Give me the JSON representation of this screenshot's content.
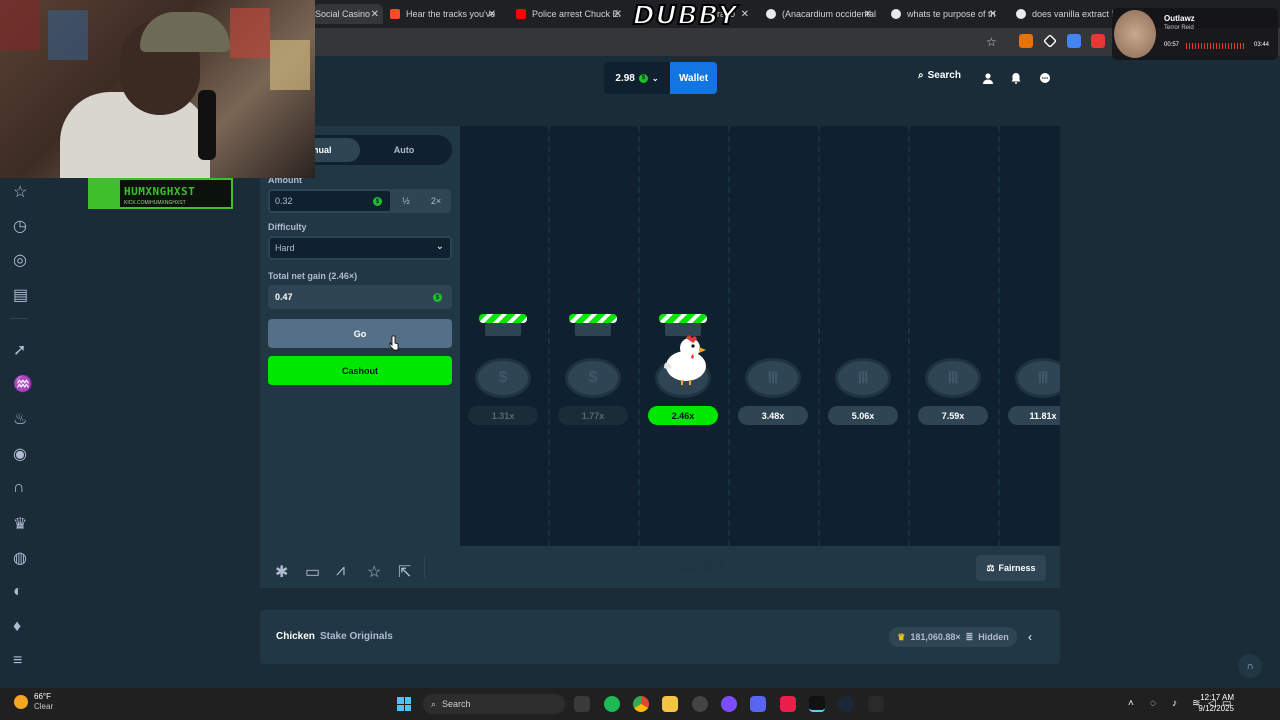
{
  "browser": {
    "tabs": [
      {
        "title": "Social Casino",
        "active": true
      },
      {
        "title": "Hear the tracks you've",
        "active": false
      },
      {
        "title": "Police arrest Chuck E.",
        "active": false
      },
      {
        "title": "rapo",
        "active": false
      },
      {
        "title": "(Anacardium occidentale",
        "active": false
      },
      {
        "title": "whats te purpose of th",
        "active": false
      },
      {
        "title": "does vanilla extract ha",
        "active": false
      }
    ]
  },
  "header": {
    "balance": "2.98",
    "wallet_label": "Wallet",
    "search_label": "Search"
  },
  "controls": {
    "mode_tabs": [
      "Manual",
      "Auto"
    ],
    "amount_label": "Amount",
    "amount_value": "0.32",
    "half_label": "½",
    "double_label": "2×",
    "difficulty_label": "Difficulty",
    "difficulty_value": "Hard",
    "net_gain_label": "Total net gain (2.46×)",
    "net_gain_value": "0.47",
    "go_label": "Go",
    "cashout_label": "Cashout"
  },
  "board": {
    "multipliers": [
      "1.31x",
      "1.77x",
      "2.46x",
      "3.48x",
      "5.06x",
      "7.59x",
      "11.81x"
    ],
    "current_step": 3
  },
  "footer": {
    "watermark": "Stake",
    "fairness_label": "Fairness"
  },
  "info": {
    "game_name": "Chicken",
    "provider": "Stake Originals",
    "max_win": "181,060.88×",
    "hidden_label": "Hidden"
  },
  "overlay": {
    "streamer_name": "HUMXNGHXST",
    "streamer_url": "KICK.COM/HUMXNGHXST",
    "dubby_text": "DUBBY",
    "raid_title": "Outlawz",
    "raid_sub": "Terror Reid",
    "raid_time_start": "00:57",
    "raid_time_end": "03:44"
  },
  "taskbar": {
    "temperature": "66°F",
    "condition": "Clear",
    "search_label": "Search",
    "time": "12:17 AM",
    "date": "9/12/2025"
  },
  "colors": {
    "accent_green": "#00e701",
    "wallet_blue": "#1475e1",
    "bg": "#1a2c38",
    "board_bg": "#0f212e"
  }
}
